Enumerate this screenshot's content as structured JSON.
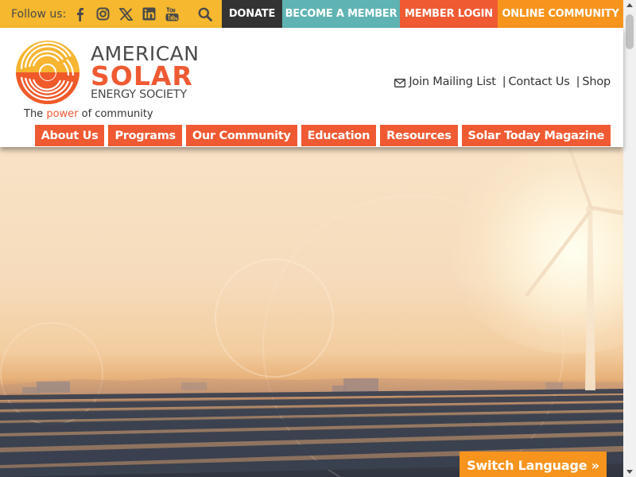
{
  "topbar": {
    "follow_label": "Follow us:",
    "social_icons": [
      "facebook-icon",
      "instagram-icon",
      "x-icon",
      "linkedin-icon",
      "youtube-icon"
    ],
    "buttons": {
      "donate": "DONATE",
      "become_member": "BECOME A MEMBER",
      "member_login": "MEMBER LOGIN",
      "online_community": "ONLINE COMMUNITY"
    }
  },
  "logo": {
    "line1": "AMERICAN",
    "line2": "SOLAR",
    "line3": "ENERGY SOCIETY",
    "tagline_pre": "The ",
    "tagline_power": "power",
    "tagline_post": " of community"
  },
  "utility": {
    "mailing": "Join Mailing List",
    "contact": "Contact Us",
    "shop": "Shop",
    "sep": "|"
  },
  "nav": [
    {
      "label": "About Us"
    },
    {
      "label": "Programs"
    },
    {
      "label": "Our Community"
    },
    {
      "label": "Education"
    },
    {
      "label": "Resources"
    },
    {
      "label": "Solar Today Magazine"
    }
  ],
  "switch_language": "Switch Language »",
  "colors": {
    "topbar": "#f5b82e",
    "orange_red": "#ef5a33",
    "teal": "#5fb3b3",
    "orange": "#f7941d",
    "dark": "#333333"
  }
}
